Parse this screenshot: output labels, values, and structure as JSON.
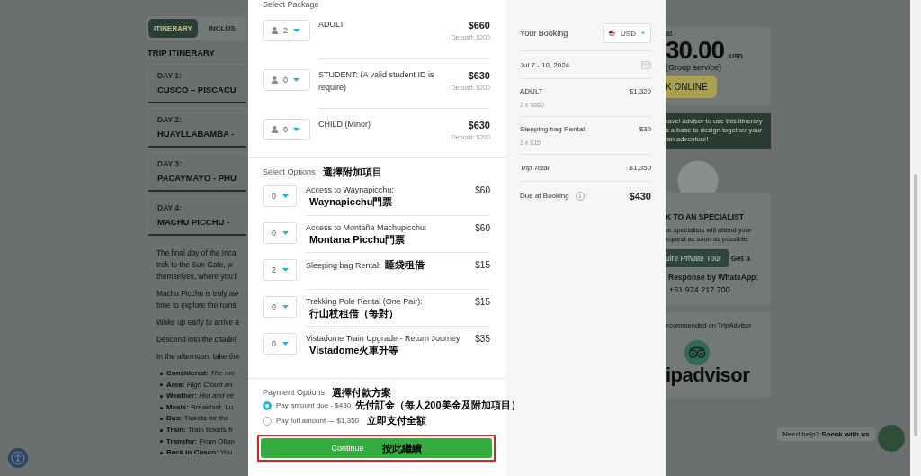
{
  "itinerary_page": {
    "tabs": [
      {
        "label": "ITINERARY",
        "selected": true
      },
      {
        "label": "INCLUS",
        "selected": false
      }
    ],
    "section_title": "TRIP ITINERARY",
    "days": [
      {
        "label": "DAY 1:",
        "title": "CUSCO – PISCACU"
      },
      {
        "label": "DAY 2:",
        "title": "HUAYLLABAMBA -"
      },
      {
        "label": "DAY 3:",
        "title": "PACAYMAYO - PHU"
      },
      {
        "label": "DAY 4:",
        "title": "MACHU PICCHU -"
      }
    ],
    "paragraphs": [
      [
        "The final day of the Inca",
        "trek to the Sun Gate, w",
        "themselves, where you'll"
      ],
      [
        "Machu Picchu is truly aw",
        "time to explore the ruins"
      ],
      [
        "Wake up early to arrive a"
      ],
      [
        "Descend into the citadel"
      ],
      [
        "In the afternoon, take the"
      ]
    ],
    "details": [
      "**Considered:** *The mo*",
      "**Area:** *High Cloud an*",
      "**Weather:** *Hot and ve*",
      "**Meals:** Breakfast, Lu",
      "**Bus:** Tickets for the",
      "**Train:** Train tickets fr",
      "**Transfer:** From Ollan",
      "**Back in Cusco:** You"
    ]
  },
  "booking": {
    "package": {
      "title": "Select Package",
      "items": [
        {
          "quantity": "2",
          "name": "ADULT",
          "price": "$660",
          "deposit": "Deposit: $200"
        },
        {
          "quantity": "0",
          "name": "STUDENT: (A valid student ID is require)",
          "price": "$630",
          "deposit": "Deposit: $200"
        },
        {
          "quantity": "0",
          "name": "CHILD (Minor)",
          "price": "$630",
          "deposit": "Deposit: $200"
        }
      ]
    },
    "options": {
      "title": "Select Options",
      "note": "選擇附加項目",
      "items": [
        {
          "quantity": "0",
          "name": "Access to Waynapicchu:",
          "note": "Waynapicchu門票",
          "price": "$60"
        },
        {
          "quantity": "0",
          "name": "Access to Montaña Machupicchu:",
          "note": "Montana  Picchu門票",
          "price": "$60"
        },
        {
          "quantity": "2",
          "name": "Sleeping bag Rental:",
          "note": "睡袋租借",
          "price": "$15"
        },
        {
          "quantity": "0",
          "name": "Trekking Pole Rental (One Pair):",
          "note": "行山杖租借（每對）",
          "price": "$15"
        },
        {
          "quantity": "0",
          "name": "Vistadome Train Upgrade - Return Journey",
          "note": "Vistadome火車升等",
          "price": "$35"
        }
      ]
    },
    "payment": {
      "title": "Payment Options",
      "note": "選擇付款方案",
      "choices": [
        {
          "label": "Pay amount due - $430",
          "note": "先付訂金（每人200美金及附加項目）",
          "selected": true
        },
        {
          "label": "Pay full amount — $1,350",
          "note": "立即支付全額",
          "selected": false
        }
      ]
    },
    "continue_button": {
      "label": "Continue",
      "note": "按此繼續",
      "highlighted": true
    }
  },
  "summary": {
    "title": "Your Booking",
    "currency": "USD",
    "dates": "Jul 7 - 10, 2024",
    "lines": [
      {
        "name": "ADULT",
        "detail": "2 x $660",
        "amount": "$1,320"
      },
      {
        "name": "Sleeping bag Rental:",
        "detail": "2 x $15",
        "amount": "$30"
      }
    ],
    "trip_total": {
      "label": "Trip Total",
      "amount": "$1,350"
    },
    "due": {
      "label": "Due at Booking",
      "amount": "$430"
    }
  },
  "sidebar": {
    "price_card": {
      "prefix": "at",
      "price": "30.00",
      "currency": "USD",
      "basis": "(Group service)",
      "book_button": "K ONLINE"
    },
    "advisor_banner": [
      "ravel advisor to use this itinerary",
      "s a base to design together your",
      "ian adventure!"
    ],
    "specialist": {
      "title": "K TO AN SPECIALIST",
      "text": [
        "ur specialists will attend your",
        "equest as soon as possible."
      ],
      "button": "uire Private Tour",
      "link": "Get a",
      "whatsapp_label": "Response by WhatsApp:",
      "phone": "+51 974 217 700"
    },
    "tripadvisor": {
      "caption": "ecommended on TripAdvisor",
      "logo_text": "ipadvisor"
    }
  },
  "chat": {
    "text": "Need help? **Speak with us**"
  }
}
